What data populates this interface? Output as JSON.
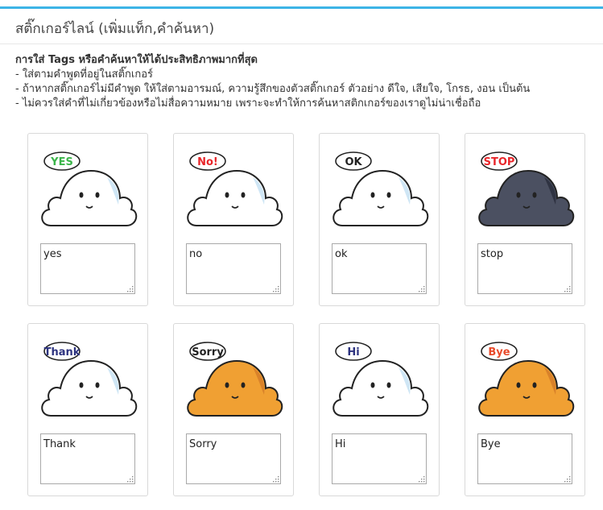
{
  "header": {
    "title": "สติ๊กเกอร์ไลน์ (เพิ่มแท็ก,คำค้นหา)"
  },
  "instructions": {
    "lead_prefix": "การใส่ ",
    "lead_bold": "Tags",
    "lead_suffix": " หรือคำค้นหาให้ได้ประสิทธิภาพมากที่สุด",
    "lines": [
      "- ใส่ตามคำพูดที่อยู่ในสติ๊กเกอร์",
      "- ถ้าหากสติ๊กเกอร์ไม่มีคำพูด ให้ใส่ตามอารมณ์, ความรู้สึกของตัวสติ๊กเกอร์ ตัวอย่าง ดีใจ, เสียใจ, โกรธ, งอน เป็นต้น",
      "- ไม่ควรใส่คำที่ไม่เกี่ยวข้องหรือไม่สื่อความหมาย เพราะจะทำให้การค้นหาสติกเกอร์ของเราดูไม่น่าเชื่อถือ"
    ]
  },
  "stickers": [
    {
      "caption": "YES",
      "tag": "yes",
      "body_color": "#ffffff",
      "caption_color": "#3bb54a"
    },
    {
      "caption": "No!",
      "tag": "no",
      "body_color": "#ffffff",
      "caption_color": "#e8262a"
    },
    {
      "caption": "OK",
      "tag": "ok",
      "body_color": "#ffffff",
      "caption_color": "#222222"
    },
    {
      "caption": "STOP",
      "tag": "stop",
      "body_color": "#4b5061",
      "caption_color": "#e8262a"
    },
    {
      "caption": "Thank",
      "tag": "Thank",
      "body_color": "#ffffff",
      "caption_color": "#2d3380"
    },
    {
      "caption": "Sorry",
      "tag": "Sorry",
      "body_color": "#f0a033",
      "caption_color": "#222222"
    },
    {
      "caption": "Hi",
      "tag": "Hi",
      "body_color": "#ffffff",
      "caption_color": "#2d3380"
    },
    {
      "caption": "Bye",
      "tag": "Bye",
      "body_color": "#f0a033",
      "caption_color": "#e84a2a"
    }
  ]
}
